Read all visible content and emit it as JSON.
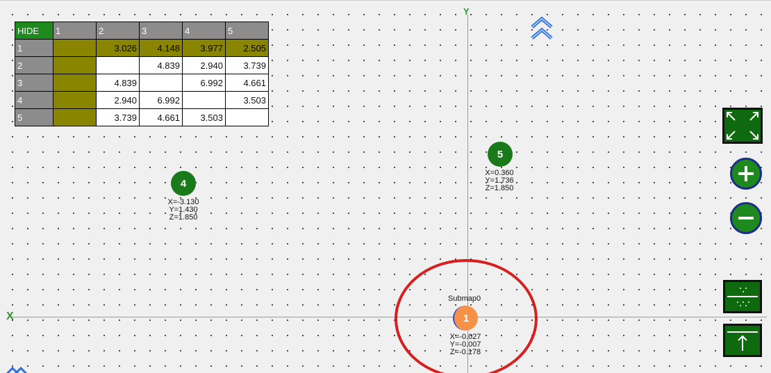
{
  "table": {
    "corner": "HIDE",
    "columns": [
      "1",
      "2",
      "3",
      "4",
      "5"
    ],
    "rows": [
      {
        "label": "1",
        "cells": [
          "",
          "3.026",
          "4.148",
          "3.977",
          "2.505"
        ]
      },
      {
        "label": "2",
        "cells": [
          "",
          "",
          "4.839",
          "2.940",
          "3.739"
        ]
      },
      {
        "label": "3",
        "cells": [
          "",
          "4.839",
          "",
          "6.992",
          "4.661"
        ]
      },
      {
        "label": "4",
        "cells": [
          "",
          "2.940",
          "6.992",
          "",
          "3.503"
        ]
      },
      {
        "label": "5",
        "cells": [
          "",
          "3.739",
          "4.661",
          "3.503",
          ""
        ]
      }
    ]
  },
  "axes": {
    "x_label": "X",
    "y_label": "Y"
  },
  "nodes": {
    "n1": {
      "id": "1",
      "x": "X=-0.027",
      "y": "Y=-0.007",
      "z": "Z=-0.178",
      "label": "Submap0"
    },
    "n4": {
      "id": "4",
      "x": "X=-3.130",
      "y": "Y=1.430",
      "z": "Z=1.850"
    },
    "n5": {
      "id": "5",
      "x": "X=0.360",
      "y": "Y=1.736",
      "z": "Z=1.850"
    }
  },
  "colors": {
    "grid_bg": "#f0f0f0",
    "node_green": "#1a7a1a",
    "origin_orange": "#f59248",
    "highlight_red": "#d61f1f",
    "axis_green": "#2e9c2e"
  },
  "icons": [
    "collapse-up-icon",
    "fit-view-icon",
    "zoom-in-icon",
    "zoom-out-icon",
    "grid-toggle-icon",
    "anchor-icon"
  ]
}
